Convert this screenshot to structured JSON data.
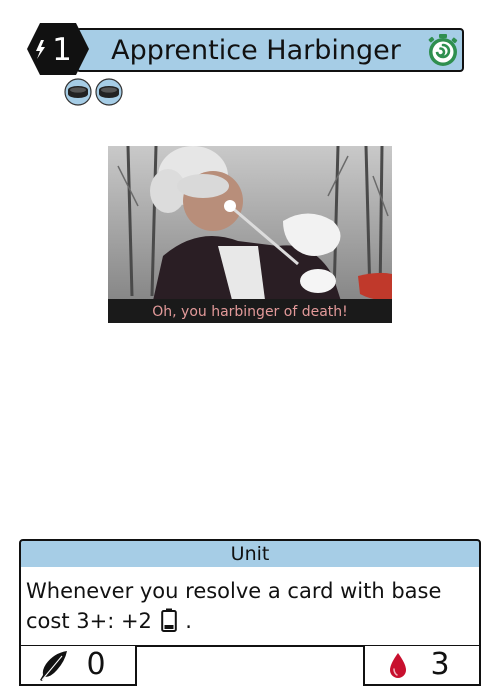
{
  "card": {
    "name": "Apprentice Harbinger",
    "cost": "1",
    "type": "Unit",
    "ability_text": "Whenever you resolve a card with base cost 3+: +2",
    "ability_suffix": ".",
    "attack": "0",
    "health": "3"
  },
  "artwork": {
    "caption": "Oh, you harbinger of death!"
  },
  "icons": {
    "cost": "lightning-icon",
    "speed": "stopwatch-icon",
    "tokens": [
      "coin-token-icon",
      "coin-token-icon"
    ],
    "ability": "battery-icon",
    "attack": "feather-icon",
    "health": "blood-drop-icon"
  },
  "colors": {
    "title_bar": "#a6cde6",
    "type_bar": "#a6cde6",
    "speed_icon": "#2f8f4f",
    "blood": "#c8102e",
    "caption": "#e39a9a"
  }
}
